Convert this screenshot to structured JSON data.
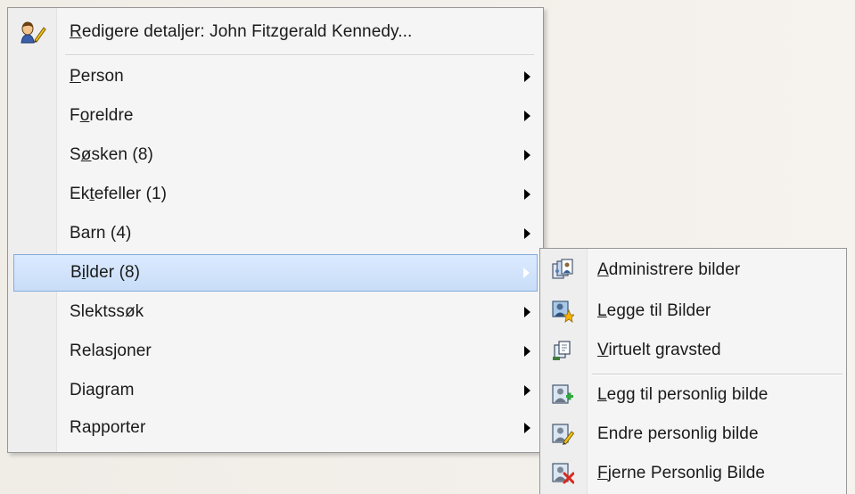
{
  "menu": {
    "header": {
      "pre": "",
      "accel": "R",
      "post": "edigere detaljer: John Fitzgerald Kennedy...",
      "icon": "edit-person-icon"
    },
    "items": [
      {
        "pre": "",
        "accel": "P",
        "post": "erson",
        "has_submenu": true
      },
      {
        "pre": "F",
        "accel": "o",
        "post": "reldre",
        "has_submenu": true
      },
      {
        "pre": "S",
        "accel": "ø",
        "post": "sken (8)",
        "has_submenu": true
      },
      {
        "pre": "Ek",
        "accel": "t",
        "post": "efeller (1)",
        "has_submenu": true
      },
      {
        "pre": "Barn (4)",
        "accel": "",
        "post": "",
        "has_submenu": true
      },
      {
        "pre": "B",
        "accel": "i",
        "post": "lder (8)",
        "has_submenu": true,
        "highlighted": true
      },
      {
        "pre": "Slektssøk",
        "accel": "",
        "post": "",
        "has_submenu": true
      },
      {
        "pre": "Relasjoner",
        "accel": "",
        "post": "",
        "has_submenu": true
      },
      {
        "pre": "Diagram",
        "accel": "",
        "post": "",
        "has_submenu": true
      },
      {
        "pre": "Rapporter",
        "accel": "",
        "post": "",
        "has_submenu": true
      }
    ]
  },
  "submenu": {
    "items": [
      {
        "pre": "",
        "accel": "A",
        "post": "dministrere bilder",
        "icon": "manage-pictures-icon"
      },
      {
        "pre": "",
        "accel": "L",
        "post": "egge til Bilder",
        "icon": "add-pictures-icon"
      },
      {
        "pre": "",
        "accel": "V",
        "post": "irtuelt gravsted",
        "icon": "virtual-grave-icon"
      },
      {
        "pre": "",
        "accel": "L",
        "post": "egg til personlig bilde",
        "icon": "add-personal-picture-icon"
      },
      {
        "pre": "Endre personlig bilde",
        "accel": "",
        "post": "",
        "icon": "edit-personal-picture-icon"
      },
      {
        "pre": "",
        "accel": "F",
        "post": "jerne Personlig Bilde",
        "icon": "remove-personal-picture-icon"
      }
    ]
  },
  "colors": {
    "menu_bg": "#f5f5f5",
    "gutter_bg": "#eeeeee",
    "highlight_bg": "#c9ddf8",
    "highlight_border": "#84acdd"
  }
}
